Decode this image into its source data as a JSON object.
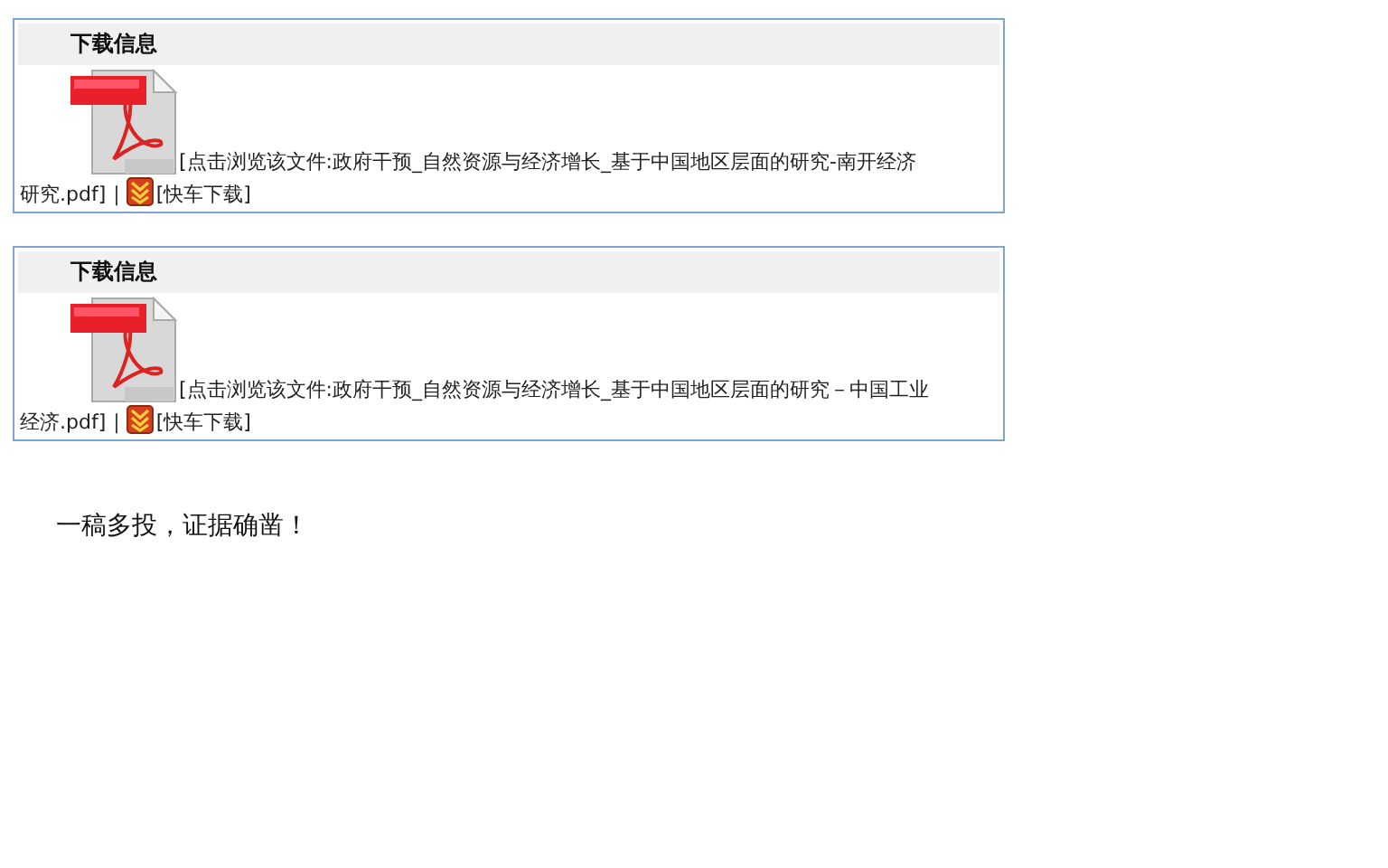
{
  "downloads": [
    {
      "heading": "下载信息",
      "file_link_lines": [
        "[点击浏览该文件:政府干预_自然资源与经济增长_基于中国地区层面的研究-南开经济",
        "研究.pdf]"
      ],
      "separator": "|",
      "fast_link": "[快车下载]"
    },
    {
      "heading": "下载信息",
      "file_link_lines": [
        "[点击浏览该文件:政府干预_自然资源与经济增长_基于中国地区层面的研究－中国工业",
        "经济.pdf]"
      ],
      "separator": "|",
      "fast_link": "[快车下载]"
    }
  ],
  "note": "一稿多投，证据确凿！"
}
